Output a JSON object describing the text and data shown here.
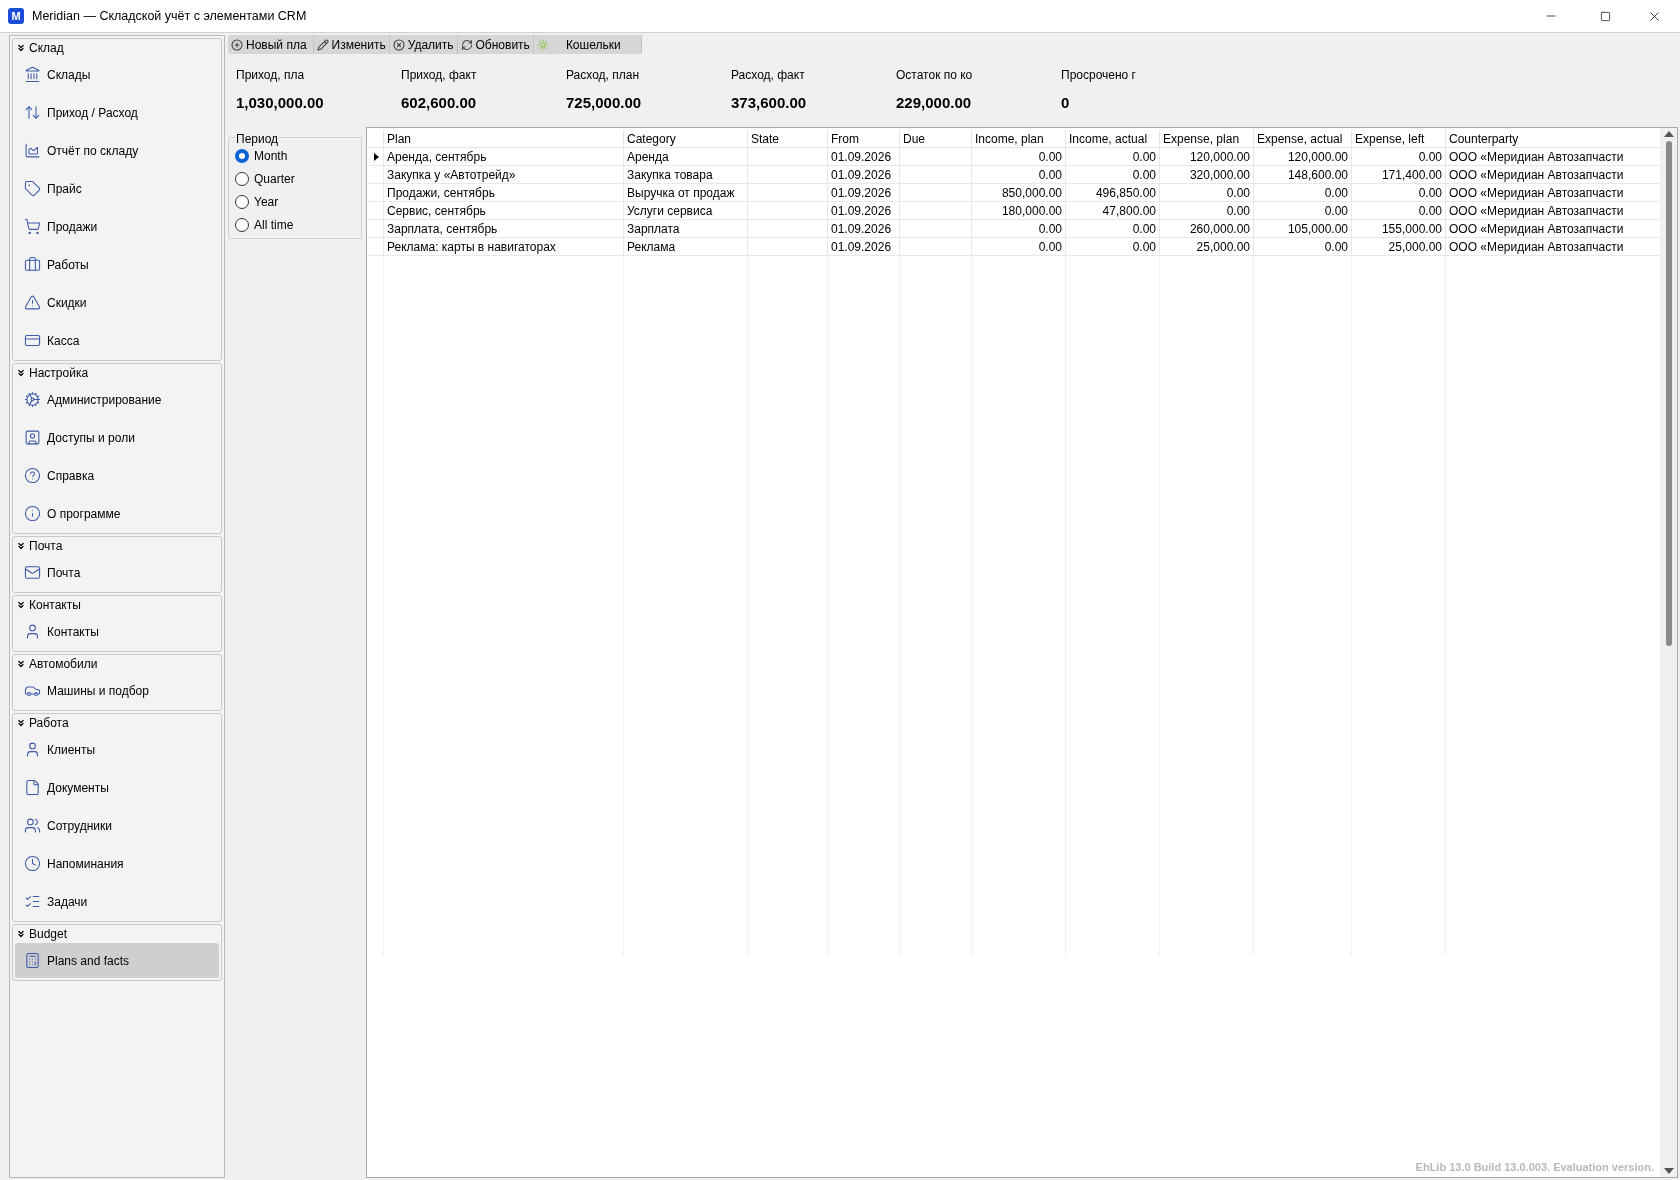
{
  "window": {
    "title": "Meridian — Складской учёт с элементами CRM",
    "logo": "M"
  },
  "sidebar": {
    "groups": [
      {
        "title": "Склад",
        "expanded": true,
        "items": [
          {
            "label": "Склады",
            "selected": false
          },
          {
            "label": "Приход / Расход",
            "selected": false
          },
          {
            "label": "Отчёт по складу",
            "selected": false
          },
          {
            "label": "Прайс",
            "selected": false
          },
          {
            "label": "Продажи",
            "selected": false
          },
          {
            "label": "Работы",
            "selected": false
          },
          {
            "label": "Скидки",
            "selected": false
          },
          {
            "label": "Касса",
            "selected": false
          }
        ]
      },
      {
        "title": "Настройка",
        "expanded": true,
        "items": [
          {
            "label": "Администрирование",
            "selected": false
          },
          {
            "label": "Доступы и роли",
            "selected": false
          },
          {
            "label": "Справка",
            "selected": false
          },
          {
            "label": "О программе",
            "selected": false
          }
        ]
      },
      {
        "title": "Почта",
        "expanded": true,
        "items": [
          {
            "label": "Почта",
            "selected": false
          }
        ]
      },
      {
        "title": "Контакты",
        "expanded": true,
        "items": [
          {
            "label": "Контакты",
            "selected": false
          }
        ]
      },
      {
        "title": "Автомобили",
        "expanded": true,
        "items": [
          {
            "label": "Машины и подбор",
            "selected": false
          }
        ]
      },
      {
        "title": "Работа",
        "expanded": true,
        "items": [
          {
            "label": "Клиенты",
            "selected": false
          },
          {
            "label": "Документы",
            "selected": false
          },
          {
            "label": "Сотрудники",
            "selected": false
          },
          {
            "label": "Напоминания",
            "selected": false
          },
          {
            "label": "Задачи",
            "selected": false
          }
        ]
      },
      {
        "title": "Budget",
        "expanded": true,
        "items": [
          {
            "label": "Plans and facts",
            "selected": true
          }
        ]
      }
    ]
  },
  "toolbar": [
    "Новый пла",
    "Изменить",
    "Удалить",
    "Обновить",
    "Кошельки"
  ],
  "summary": [
    {
      "label": "Приход, пла",
      "value": "1,030,000.00"
    },
    {
      "label": "Приход, факт",
      "value": "602,600.00"
    },
    {
      "label": "Расход, план",
      "value": "725,000.00"
    },
    {
      "label": "Расход, факт",
      "value": "373,600.00"
    },
    {
      "label": "Остаток по ко",
      "value": "229,000.00"
    },
    {
      "label": "Просрочено г",
      "value": "0"
    }
  ],
  "period": {
    "title": "Период",
    "options": [
      {
        "label": "Month",
        "selected": true
      },
      {
        "label": "Quarter",
        "selected": false
      },
      {
        "label": "Year",
        "selected": false
      },
      {
        "label": "All time",
        "selected": false
      }
    ]
  },
  "table": {
    "columns": [
      "Plan",
      "Category",
      "State",
      "From",
      "Due",
      "Income, plan",
      "Income, actual",
      "Expense, plan",
      "Expense, actual",
      "Expense, left",
      "Counterparty"
    ],
    "rows": [
      {
        "selected": true,
        "cells": [
          "Аренда, сентябрь",
          "Аренда",
          "",
          "01.09.2026",
          "",
          "0.00",
          "0.00",
          "120,000.00",
          "120,000.00",
          "0.00",
          "ООО «Меридиан Автозапчасти"
        ]
      },
      {
        "selected": false,
        "cells": [
          "Закупка у «Автотрейд»",
          "Закупка товара",
          "",
          "01.09.2026",
          "",
          "0.00",
          "0.00",
          "320,000.00",
          "148,600.00",
          "171,400.00",
          "ООО «Меридиан Автозапчасти"
        ]
      },
      {
        "selected": false,
        "cells": [
          "Продажи, сентябрь",
          "Выручка от продаж",
          "",
          "01.09.2026",
          "",
          "850,000.00",
          "496,850.00",
          "0.00",
          "0.00",
          "0.00",
          "ООО «Меридиан Автозапчасти"
        ]
      },
      {
        "selected": false,
        "cells": [
          "Сервис, сентябрь",
          "Услуги сервиса",
          "",
          "01.09.2026",
          "",
          "180,000.00",
          "47,800.00",
          "0.00",
          "0.00",
          "0.00",
          "ООО «Меридиан Автозапчасти"
        ]
      },
      {
        "selected": false,
        "cells": [
          "Зарплата, сентябрь",
          "Зарплата",
          "",
          "01.09.2026",
          "",
          "0.00",
          "0.00",
          "260,000.00",
          "105,000.00",
          "155,000.00",
          "ООО «Меридиан Автозапчасти"
        ]
      },
      {
        "selected": false,
        "cells": [
          "Реклама: карты в навигаторах",
          "Реклама",
          "",
          "01.09.2026",
          "",
          "0.00",
          "0.00",
          "25,000.00",
          "0.00",
          "25,000.00",
          "ООО «Меридиан Автозапчасти"
        ]
      }
    ],
    "footer_note": "EhLib 13.0 Build 13.0.003. Evaluation version."
  }
}
